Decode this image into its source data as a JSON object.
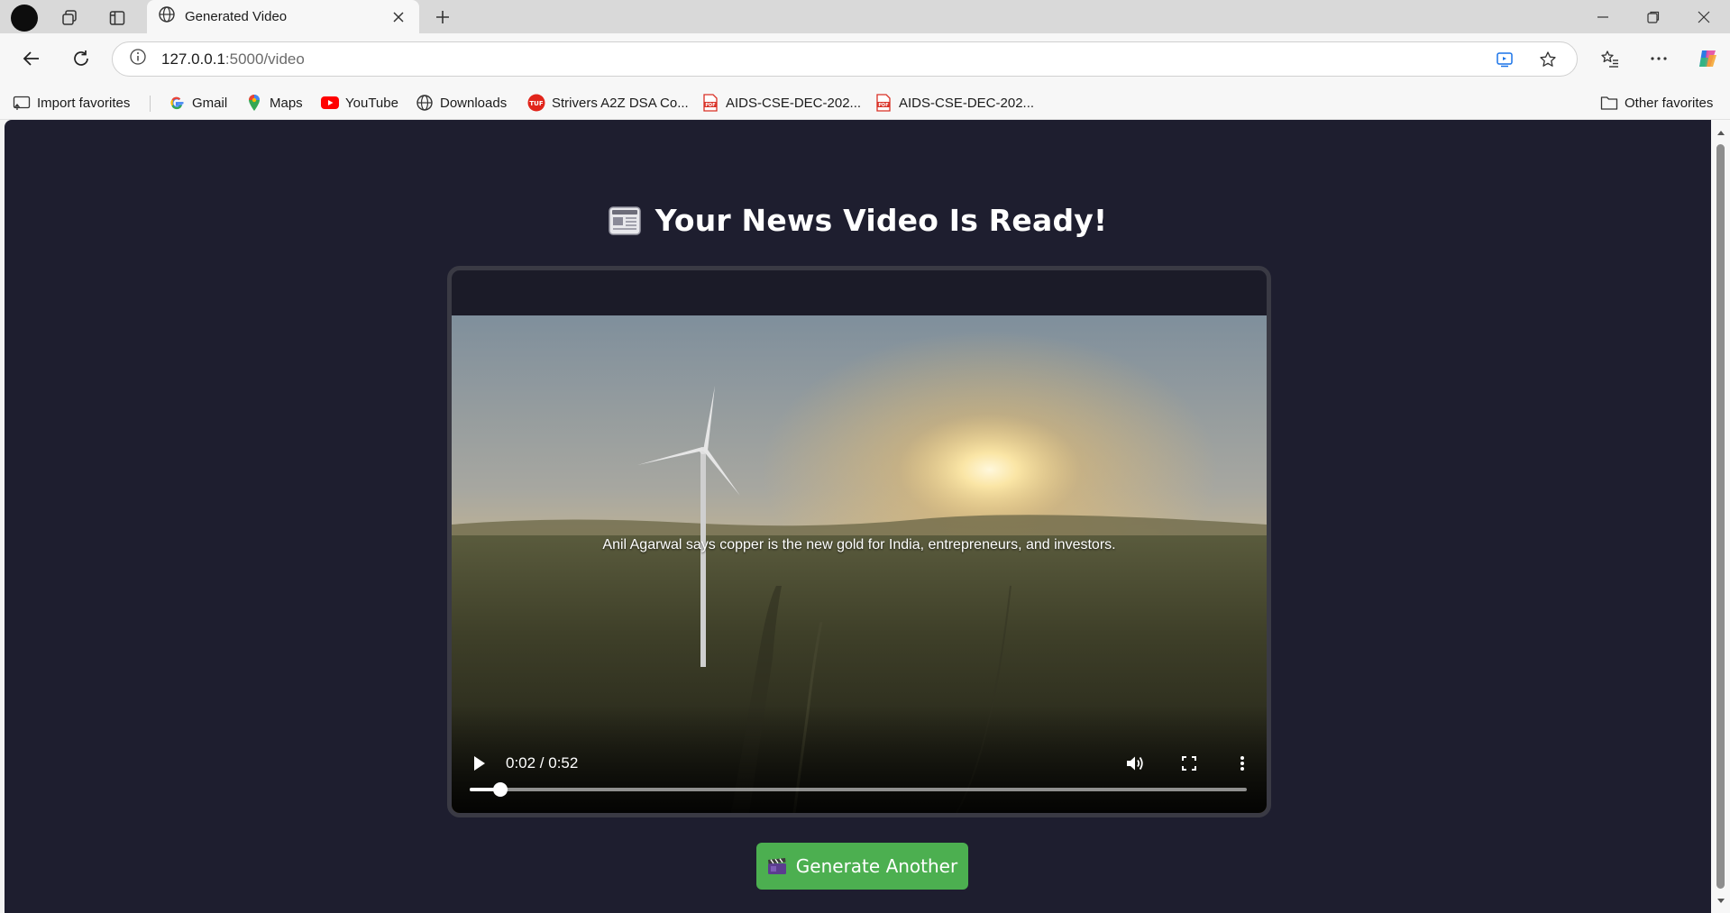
{
  "browser": {
    "tab": {
      "title": "Generated Video"
    },
    "address": {
      "host": "127.0.0.1",
      "path": ":5000/video"
    },
    "favorites": [
      {
        "label": "Import favorites",
        "icon": "import-icon"
      },
      {
        "label": "Gmail",
        "icon": "google-icon"
      },
      {
        "label": "Maps",
        "icon": "maps-pin-icon"
      },
      {
        "label": "YouTube",
        "icon": "youtube-icon"
      },
      {
        "label": "Downloads",
        "icon": "globe-icon"
      },
      {
        "label": "Strivers A2Z DSA Co...",
        "icon": "tuf-icon"
      },
      {
        "label": "AIDS-CSE-DEC-202...",
        "icon": "pdf-icon"
      },
      {
        "label": "AIDS-CSE-DEC-202...",
        "icon": "pdf-icon"
      }
    ],
    "other_favorites": "Other favorites"
  },
  "page": {
    "heading": "Your News Video Is Ready!",
    "heading_icon": "newspaper-icon",
    "video": {
      "caption": "Anil Agarwal says copper is the new gold for India, entrepreneurs, and investors.",
      "time": "0:02 / 0:52",
      "progress": 0.04
    },
    "generate_button": {
      "label": "Generate Another",
      "icon": "clapperboard-icon"
    }
  },
  "colors": {
    "page_bg": "#1e1e2f",
    "button_green": "#4caf50",
    "card_border": "#3a3a44"
  }
}
